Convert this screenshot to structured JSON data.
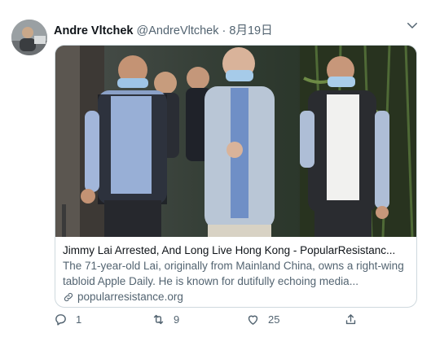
{
  "tweet": {
    "author_name": "Andre Vltchek",
    "author_handle": "@AndreVltchek",
    "date": "8月19日",
    "card": {
      "title": "Jimmy Lai Arrested, And Long Live Hong Kong - PopularResistanc...",
      "description": "The 71-year-old Lai, originally from Mainland China, owns a right-wing tabloid Apple Daily. He is known for dutifully echoing media...",
      "domain": "popularresistance.org"
    },
    "actions": {
      "reply_count": "1",
      "retweet_count": "9",
      "like_count": "25"
    }
  },
  "colors": {
    "text_primary": "#0f1419",
    "text_secondary": "#536471",
    "border": "#cfd9de"
  },
  "icons": [
    "caret-down-icon",
    "link-icon",
    "reply-icon",
    "retweet-icon",
    "like-icon",
    "share-icon"
  ]
}
